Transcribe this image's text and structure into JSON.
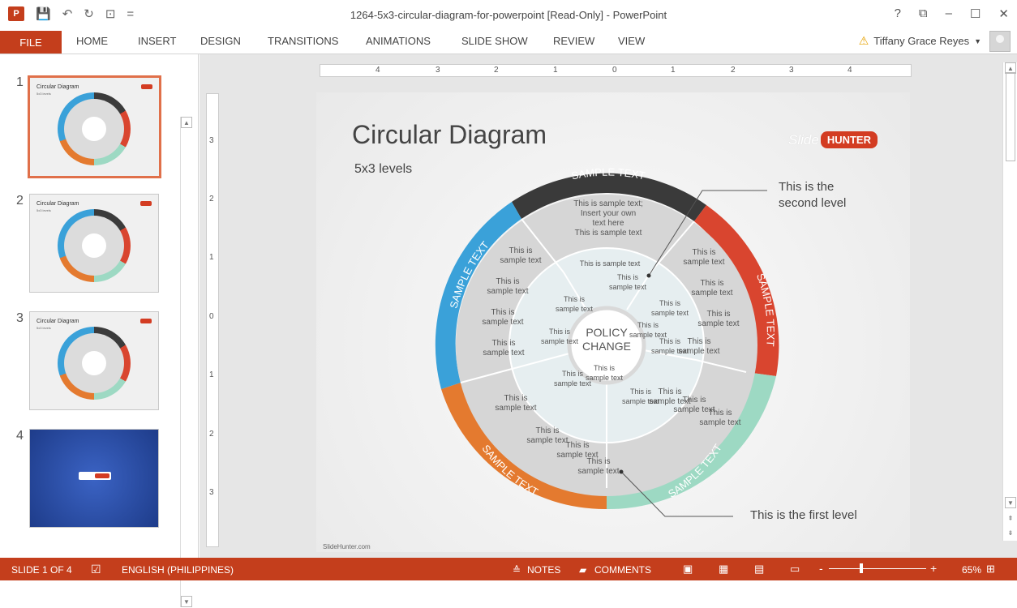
{
  "window": {
    "title": "1264-5x3-circular-diagram-for-powerpoint [Read-Only] - PowerPoint",
    "app_icon": "P",
    "controls": [
      "?",
      "⧉",
      "–",
      "☐",
      "✕"
    ]
  },
  "ribbon": {
    "file": "FILE",
    "tabs": [
      "HOME",
      "INSERT",
      "DESIGN",
      "TRANSITIONS",
      "ANIMATIONS",
      "SLIDE SHOW",
      "REVIEW",
      "VIEW"
    ],
    "user": "Tiffany Grace Reyes"
  },
  "thumbnails": [
    {
      "num": "1",
      "title": "Circular Diagram",
      "sub": "5x3 levels"
    },
    {
      "num": "2",
      "title": "Circular Diagram",
      "sub": "5x3 levels"
    },
    {
      "num": "3",
      "title": "Circular Diagram",
      "sub": "5x3 levels"
    },
    {
      "num": "4",
      "title": "",
      "sub": ""
    }
  ],
  "ruler": {
    "h": [
      "4",
      "3",
      "2",
      "1",
      "0",
      "1",
      "2",
      "3",
      "4"
    ],
    "v": [
      "3",
      "2",
      "1",
      "0",
      "1",
      "2",
      "3"
    ]
  },
  "slide": {
    "title": "Circular Diagram",
    "subtitle": "5x3 levels",
    "logo_slide": "Slide",
    "logo_hunter": "HUNTER",
    "callout_second_1": "This is the",
    "callout_second_2": "second level",
    "callout_first": "This is the first level",
    "footer": "SlideHunter.com",
    "center_1": "POLICY",
    "center_2": "CHANGE",
    "outer_labels": [
      "SAMPLE TEXT",
      "SAMPLE TEXT",
      "SAMPLE TEXT",
      "SAMPLE TEXT",
      "SAMPLE TEXT"
    ],
    "top_block": [
      "This is sample text;",
      "Insert your own",
      "text here",
      "This is sample text"
    ],
    "ring_text": "This is sample text",
    "text_this_is": "This is",
    "text_sample_text": "sample text",
    "colors": {
      "dark": "#3a3a3a",
      "red": "#d9452f",
      "mint": "#9dd9c3",
      "orange": "#e47a2f",
      "blue": "#3aa1d9"
    }
  },
  "status": {
    "slide_of": "SLIDE 1 OF 4",
    "language": "ENGLISH (PHILIPPINES)",
    "notes": "NOTES",
    "comments": "COMMENTS",
    "zoom": "65%"
  }
}
